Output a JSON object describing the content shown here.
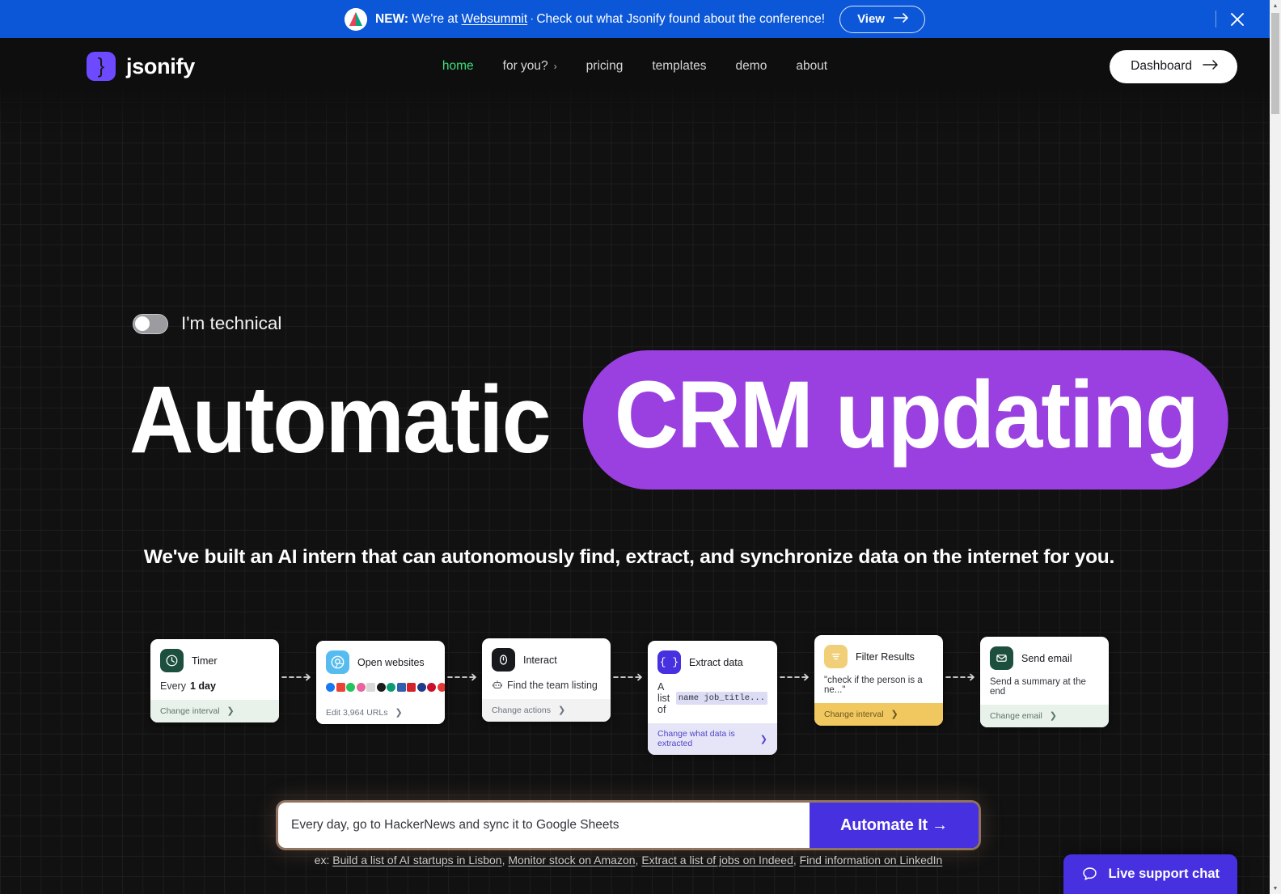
{
  "banner": {
    "logo_icon": "jsonify-mountain-logo-icon",
    "prefix": "NEW:",
    "text_before_link": " We're at ",
    "link": "Websummit",
    "separator": "·",
    "text_after_link": "Check out what Jsonify found about the conference!",
    "view_label": "View",
    "view_arrow": "→",
    "close_icon": "close-icon",
    "bg_color": "#0b57d8"
  },
  "nav": {
    "brand_mark": "}",
    "brand_name": "jsonify",
    "links": [
      {
        "label": "home",
        "active": true,
        "has_chevron": false
      },
      {
        "label": "for you?",
        "active": false,
        "has_chevron": true,
        "chevron": "›"
      },
      {
        "label": "pricing",
        "active": false,
        "has_chevron": false
      },
      {
        "label": "templates",
        "active": false,
        "has_chevron": false
      },
      {
        "label": "demo",
        "active": false,
        "has_chevron": false
      },
      {
        "label": "about",
        "active": false,
        "has_chevron": false
      }
    ],
    "dashboard_label": "Dashboard",
    "dashboard_arrow": "→",
    "active_color": "#39e07a"
  },
  "hero": {
    "toggle_label": "I'm technical",
    "toggle_on": false,
    "headline_plain": "Automatic",
    "headline_highlight": "CRM updating",
    "highlight_color": "#9a3fe0",
    "subtitle": "We've built an AI intern that can autonomously find, extract, and synchronize data on the internet for you."
  },
  "flow": {
    "arrow": "⇢",
    "steps": [
      {
        "icon_name": "clock-icon",
        "icon_bg": "#1d4f3e",
        "title": "Timer",
        "body_prefix": "Every ",
        "body_strong": "1 day",
        "footer": "Change interval",
        "footer_chev": "❯",
        "footer_bg": "#e9f2ea",
        "footer_color": "#5b7568",
        "offset": 5
      },
      {
        "icon_name": "chrome-browser-icon",
        "icon_bg": "#56bcf0",
        "title": "Open websites",
        "body_type": "favicons",
        "footer": "Edit 3,964 URLs",
        "footer_chev": "❯",
        "footer_bg": "#ffffff",
        "footer_color": "#6b7280",
        "offset": 7
      },
      {
        "icon_name": "cursor-interact-icon",
        "icon_bg": "#17191c",
        "title": "Interact",
        "body_icon": "robot-icon",
        "body_text": "Find the team listing",
        "footer": "Change actions",
        "footer_chev": "❯",
        "footer_bg": "#f2f2f2",
        "footer_color": "#6b7280",
        "offset": 4
      },
      {
        "icon_name": "curly-braces-icon",
        "icon_bg": "#4730e0",
        "title": "Extract data",
        "body_prefix": "A list of ",
        "body_chip": "name job_title...",
        "footer": "Change what data is extracted",
        "footer_chev": "❯",
        "footer_bg": "#e6e5f8",
        "footer_color": "#4f46c9",
        "offset": 7
      },
      {
        "icon_name": "filter-lines-icon",
        "icon_bg": "#f0cf78",
        "title": "Filter Results",
        "body_text": "\"check if the person is a ne...\"",
        "footer": "Change interval",
        "footer_chev": "❯",
        "footer_bg": "#f0c85f",
        "footer_color": "#6b5620",
        "offset": 0
      },
      {
        "icon_name": "envelope-icon",
        "icon_bg": "#1d4f3e",
        "title": "Send email",
        "body_text": "Send a summary at the end",
        "footer": "Change email",
        "footer_chev": "❯",
        "footer_bg": "#e9f2ea",
        "footer_color": "#5b7568",
        "offset": 2
      }
    ],
    "favicon_colors": [
      "#1877f2",
      "#ea4335",
      "#21c45d",
      "#e8649b",
      "#f0f0f0",
      "#1b1b1b",
      "#0b9c76",
      "#2f5fb0",
      "#d2232a",
      "#1e3a8a",
      "#c8102e",
      "#e53935",
      "#ef4123"
    ]
  },
  "prompt": {
    "placeholder": "Every day, go to HackerNews and sync it to Google Sheets",
    "value": "",
    "button_label": "Automate It →",
    "button_color": "#4730e0"
  },
  "examples": {
    "prefix": "ex: ",
    "links": [
      "Build a list of AI startups in Lisbon",
      "Monitor stock on Amazon",
      "Extract a list of jobs on Indeed",
      "Find information on LinkedIn"
    ],
    "separator": ", "
  },
  "chat": {
    "icon_name": "speech-bubble-icon",
    "label": "Live support chat",
    "bg_color": "#4730e0"
  },
  "scrollbar": {
    "up_arrow": "▲",
    "down_arrow": "▼"
  }
}
